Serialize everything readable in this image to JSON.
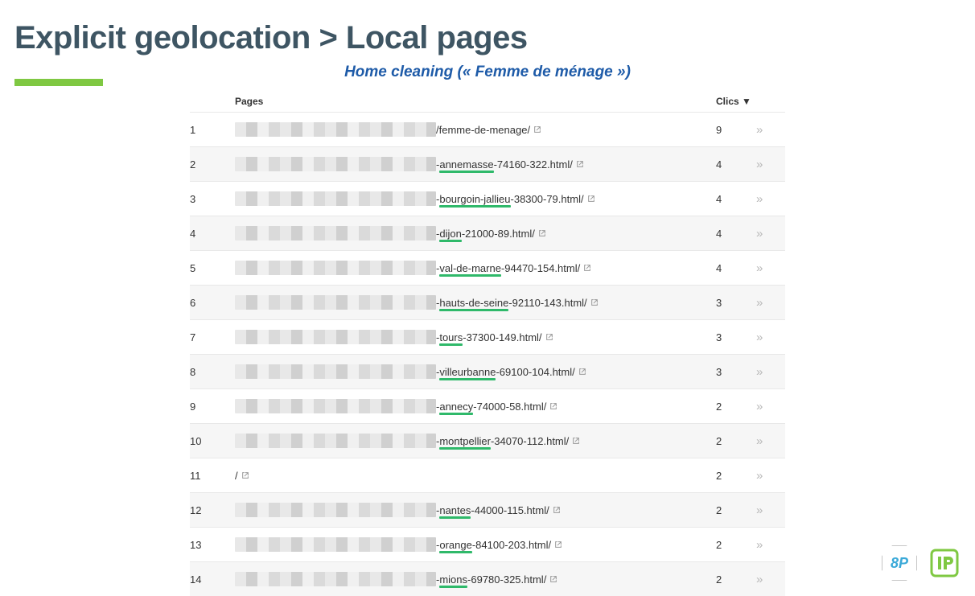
{
  "title": "Explicit geolocation > Local pages",
  "subtitle": "Home cleaning (« Femme de ménage »)",
  "columns": {
    "pages": "Pages",
    "clics": "Clics ▼"
  },
  "rows": [
    {
      "idx": "1",
      "blur_w": 250,
      "url": "/femme-de-menage/",
      "underline": null,
      "clics": "9"
    },
    {
      "idx": "2",
      "blur_w": 250,
      "url": "-annemasse-74160-322.html/",
      "underline": "annemasse",
      "clics": "4"
    },
    {
      "idx": "3",
      "blur_w": 250,
      "url": "-bourgoin-jallieu-38300-79.html/",
      "underline": "bourgoin-jallieu",
      "clics": "4"
    },
    {
      "idx": "4",
      "blur_w": 250,
      "url": "-dijon-21000-89.html/",
      "underline": "dijon",
      "clics": "4"
    },
    {
      "idx": "5",
      "blur_w": 250,
      "url": "-val-de-marne-94470-154.html/",
      "underline": "val-de-marne",
      "clics": "4"
    },
    {
      "idx": "6",
      "blur_w": 250,
      "url": "-hauts-de-seine-92110-143.html/",
      "underline": "hauts-de-seine",
      "clics": "3"
    },
    {
      "idx": "7",
      "blur_w": 250,
      "url": "-tours-37300-149.html/",
      "underline": "tours",
      "clics": "3"
    },
    {
      "idx": "8",
      "blur_w": 250,
      "url": "-villeurbanne-69100-104.html/",
      "underline": "villeurbanne",
      "clics": "3"
    },
    {
      "idx": "9",
      "blur_w": 250,
      "url": "-annecy-74000-58.html/",
      "underline": "annecy",
      "clics": "2"
    },
    {
      "idx": "10",
      "blur_w": 250,
      "url": "-montpellier-34070-112.html/",
      "underline": "montpellier",
      "clics": "2"
    },
    {
      "idx": "11",
      "blur_w": 0,
      "url": "/",
      "underline": null,
      "clics": "2"
    },
    {
      "idx": "12",
      "blur_w": 250,
      "url": "-nantes-44000-115.html/",
      "underline": "nantes",
      "clics": "2"
    },
    {
      "idx": "13",
      "blur_w": 250,
      "url": "-orange-84100-203.html/",
      "underline": "orange",
      "clics": "2"
    },
    {
      "idx": "14",
      "blur_w": 250,
      "url": "-mions-69780-325.html/",
      "underline": "mions",
      "clics": "2"
    }
  ],
  "logos": {
    "eight_p": "8P"
  }
}
